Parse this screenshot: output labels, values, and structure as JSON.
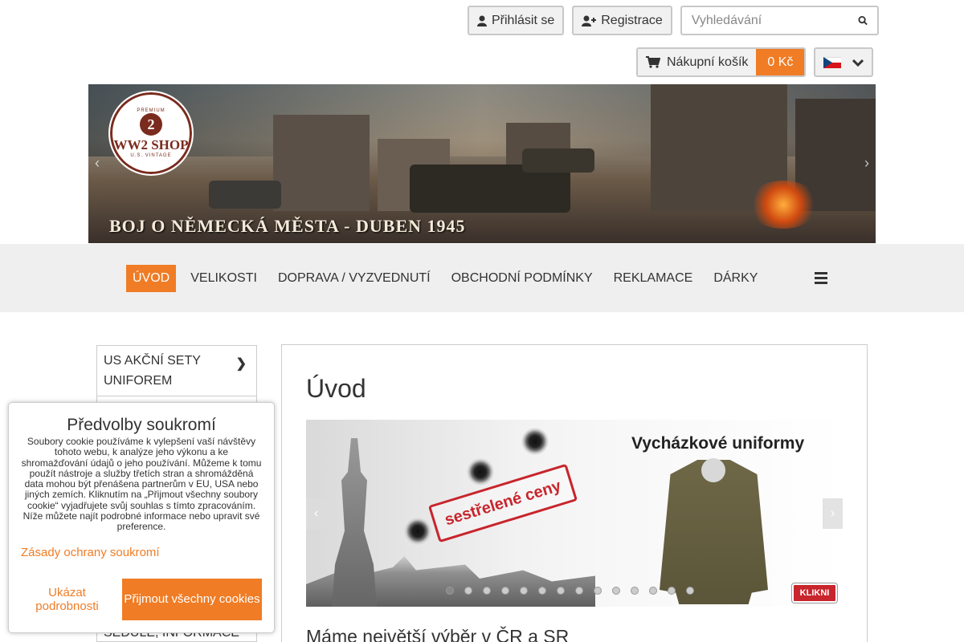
{
  "header": {
    "login_label": "Přihlásit se",
    "register_label": "Registrace",
    "search_placeholder": "Vyhledávání",
    "cart_label": "Nákupní košík",
    "cart_price": "0 Kč"
  },
  "banner": {
    "logo_number": "2",
    "logo_name": "WW2 SHOP",
    "logo_top": "PREMIUM",
    "logo_bottom": "U.S. VINTAGE",
    "caption": "Boj o německá města - duben 1945"
  },
  "nav": {
    "items": [
      "ÚVOD",
      "VELIKOSTI",
      "DOPRAVA / VYZVEDNUTÍ",
      "OBCHODNÍ PODMÍNKY",
      "REKLAMACE",
      "DÁRKY"
    ]
  },
  "sidebar": {
    "items": [
      "US AKČNÍ SETY UNIFOREM"
    ],
    "bottom_partial": "SEDULE, INFORMACE"
  },
  "main": {
    "title": "Úvod",
    "slide_title": "Vycházkové uniformy",
    "slide_stamp": "sestřelené ceny",
    "slide_button": "KLIKNI",
    "subheading": "Máme největší výběr v ČR a SR"
  },
  "cookie": {
    "title": "Předvolby soukromí",
    "text": "Soubory cookie používáme k vylepšení vaší návštěvy tohoto webu, k analýze jeho výkonu a ke shromažďování údajů o jeho používání. Můžeme k tomu použít nástroje a služby třetích stran a shromážděná data mohou být přenášena partnerům v EU, USA nebo jiných zemích. Kliknutím na „Přijmout všechny soubory cookie“ vyjadřujete svůj souhlas s tímto zpracováním. Níže můžete najít podrobné informace nebo upravit své preference.",
    "policy_link": "Zásady ochrany soukromí",
    "details_button": "Ukázat podrobnosti",
    "accept_button": "Přijmout všechny cookies"
  },
  "colors": {
    "accent": "#f07c25",
    "nav_bg": "#efefef",
    "border": "#c8c8c8"
  },
  "icons": [
    "user-icon",
    "user-plus-icon",
    "search-icon",
    "cart-icon",
    "czech-flag-icon",
    "chevron-down-icon",
    "hamburger-icon",
    "chevron-right-icon"
  ]
}
